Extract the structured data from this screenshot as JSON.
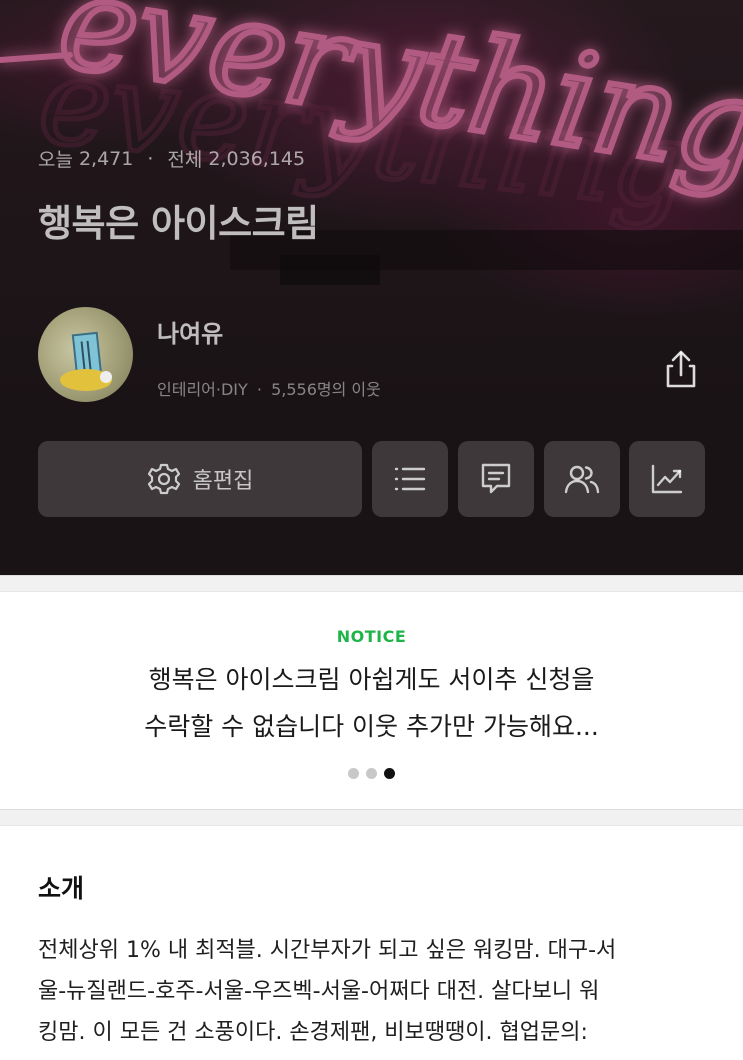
{
  "hero": {
    "today_label": "오늘",
    "today_count": "2,471",
    "separator": "·",
    "total_label": "전체",
    "total_count": "2,036,145",
    "blog_title": "행복은 아이스크림",
    "nickname": "나여유",
    "category": "인테리어·DIY",
    "neighbor_sep": "·",
    "neighbors": "5,556명의 이웃",
    "bg_neon_word": "everything",
    "neon_color": "#f07ab0"
  },
  "actions": {
    "edit_label": "홈편집",
    "icons": [
      "gear-icon",
      "list-icon",
      "message-icon",
      "people-icon",
      "chart-icon",
      "share-icon"
    ]
  },
  "notice": {
    "label": "NOTICE",
    "line1": "행복은 아이스크림 아쉽게도 서이추 신청을",
    "line2": "수락할 수 없습니다 이웃 추가만 가능해요...",
    "pages": 3,
    "current_page": 3,
    "accent": "#1fb44a"
  },
  "intro": {
    "title": "소개",
    "line1": "전체상위 1% 내 최적블. 시간부자가 되고 싶은 워킹맘. 대구-서",
    "line2": "울-뉴질랜드-호주-서울-우즈벡-서울-어쩌다 대전. 살다보니 워",
    "line3": "킹맘. 이 모든 건 소풍이다. 손경제팬, 비보땡땡이. 협업문의:"
  }
}
